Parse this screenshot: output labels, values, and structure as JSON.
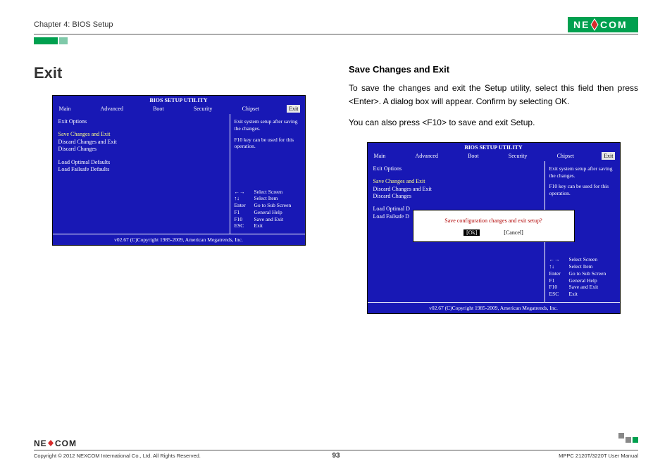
{
  "header": {
    "chapter": "Chapter 4: BIOS Setup",
    "logo_text": "NE COM"
  },
  "left": {
    "heading": "Exit"
  },
  "right": {
    "subheading": "Save Changes and Exit",
    "para1": "To save the changes and exit the Setup utility, select this field then press <Enter>. A dialog box will appear. Confirm by selecting OK.",
    "para2": "You can also press <F10> to save and exit Setup."
  },
  "bios": {
    "title": "BIOS SETUP UTILITY",
    "tabs": {
      "main": "Main",
      "advanced": "Advanced",
      "boot": "Boot",
      "security": "Security",
      "chipset": "Chipset",
      "exit": "Exit"
    },
    "left_panel": {
      "exit_options": "Exit Options",
      "save_exit": "Save Changes and Exit",
      "discard_exit": "Discard Changes and Exit",
      "discard": "Discard Changes",
      "load_optimal": "Load Optimal Defaults",
      "load_failsafe": "Load Failsafe Defaults",
      "load_optimal_cut": "Load Optimal D",
      "load_failsafe_cut": "Load Failsafe D"
    },
    "right_panel": {
      "help1": "Exit system setup after saving the changes.",
      "help2": "F10 key can be used for this operation.",
      "k_lr": "←→",
      "d_lr": "Select Screen",
      "k_ud": "↑↓",
      "d_ud": "Select Item",
      "k_enter": "Enter",
      "d_enter": "Go to Sub Screen",
      "k_f1": "F1",
      "d_f1": "General Help",
      "k_f10": "F10",
      "d_f10": "Save and Exit",
      "k_esc": "ESC",
      "d_esc": "Exit"
    },
    "footer": "v02.67 (C)Copyright 1985-2009, American Megatrends, Inc."
  },
  "dialog": {
    "msg": "Save configuration changes and exit setup?",
    "ok": "[Ok]",
    "cancel": "[Cancel]"
  },
  "footer": {
    "logo": "NE COM",
    "copyright": "Copyright © 2012 NEXCOM International Co., Ltd. All Rights Reserved.",
    "page": "93",
    "manual": "MPPC 2120T/3220T User Manual"
  }
}
